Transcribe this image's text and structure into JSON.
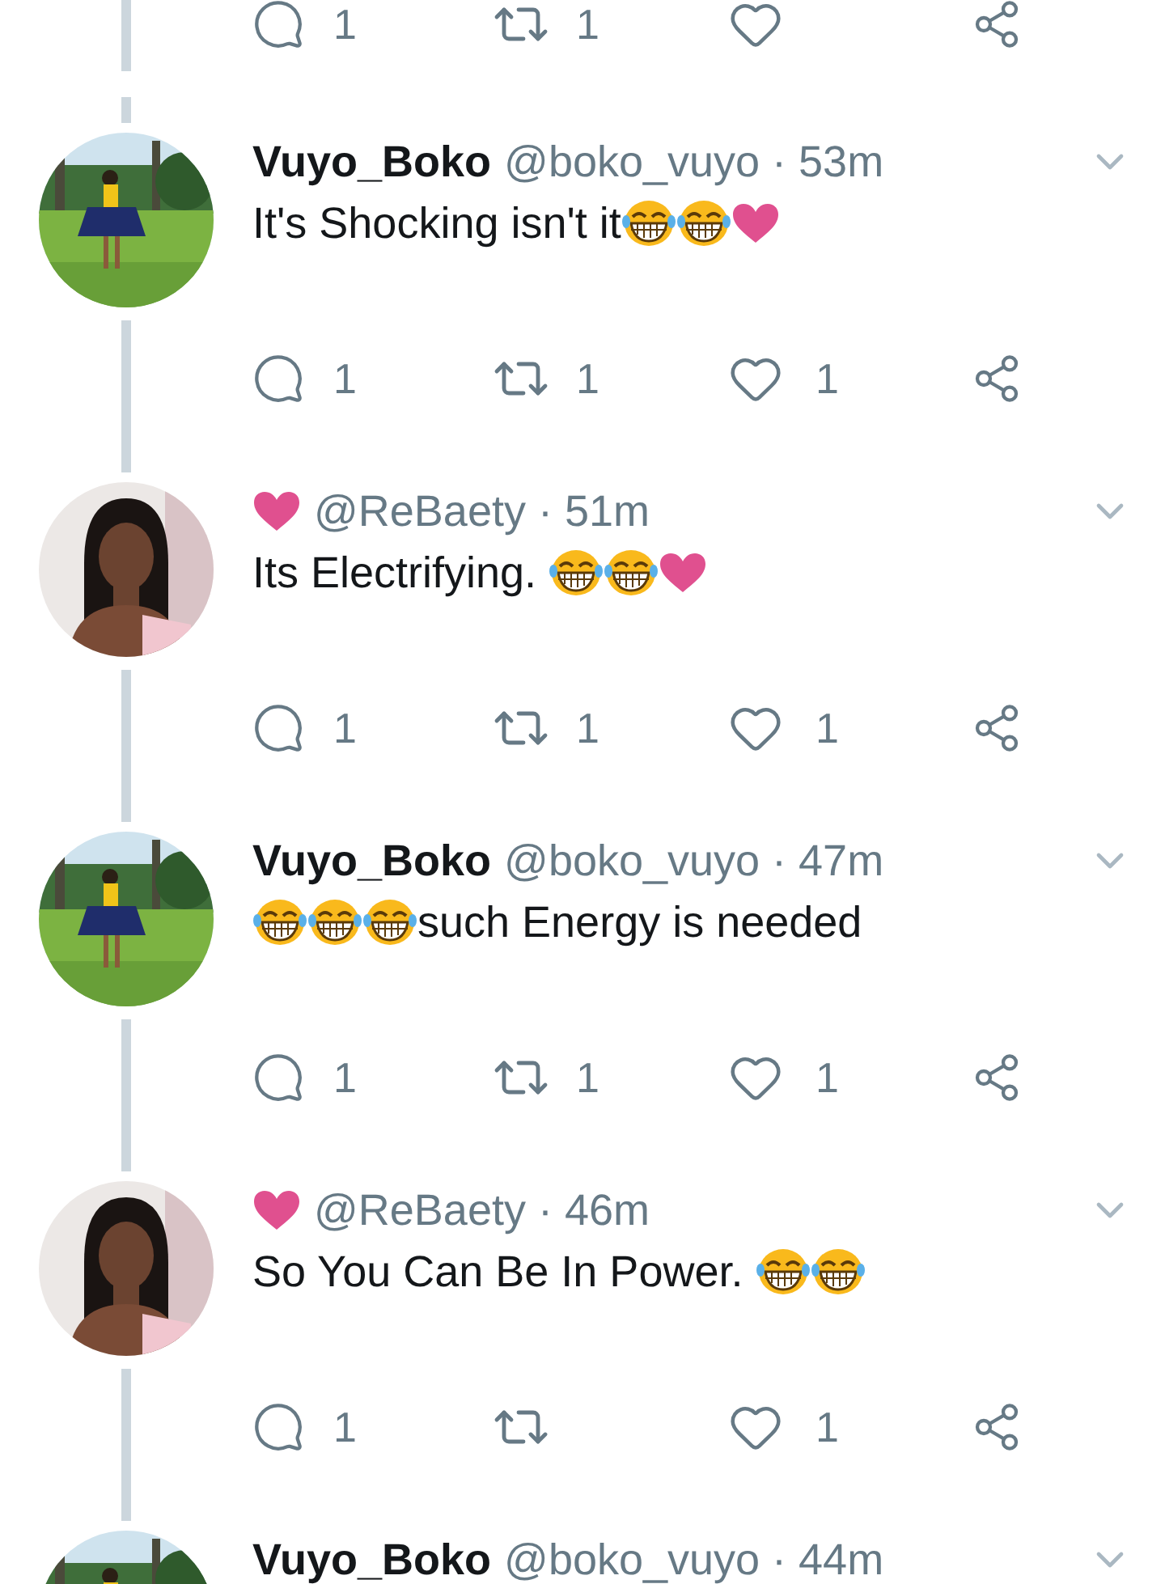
{
  "tweets": [
    {
      "actions": {
        "replies": "1",
        "retweets": "1"
      }
    },
    {
      "name": [
        {
          "kind": "text",
          "text": "Vuyo_Boko"
        }
      ],
      "meta": "@boko_vuyo · 53m",
      "body": [
        {
          "kind": "text",
          "text": "It's Shocking isn't it"
        },
        {
          "kind": "laugh"
        },
        {
          "kind": "laugh"
        },
        {
          "kind": "heart"
        }
      ],
      "actions": {
        "replies": "1",
        "retweets": "1",
        "likes": "1"
      }
    },
    {
      "name": [
        {
          "kind": "heart"
        }
      ],
      "meta": "@ReBaety · 51m",
      "body": [
        {
          "kind": "text",
          "text": "Its Electrifying. "
        },
        {
          "kind": "laugh"
        },
        {
          "kind": "laugh"
        },
        {
          "kind": "heart"
        }
      ],
      "actions": {
        "replies": "1",
        "retweets": "1",
        "likes": "1"
      }
    },
    {
      "name": [
        {
          "kind": "text",
          "text": "Vuyo_Boko"
        }
      ],
      "meta": "@boko_vuyo · 47m",
      "body": [
        {
          "kind": "laugh"
        },
        {
          "kind": "laugh"
        },
        {
          "kind": "laugh"
        },
        {
          "kind": "text",
          "text": "such Energy is needed"
        }
      ],
      "actions": {
        "replies": "1",
        "retweets": "1",
        "likes": "1"
      }
    },
    {
      "name": [
        {
          "kind": "heart"
        }
      ],
      "meta": "@ReBaety · 46m",
      "body": [
        {
          "kind": "text",
          "text": "So You Can Be In Power. "
        },
        {
          "kind": "laugh"
        },
        {
          "kind": "laugh"
        }
      ],
      "actions": {
        "replies": "1",
        "likes": "1"
      }
    },
    {
      "name": [
        {
          "kind": "text",
          "text": "Vuyo_Boko"
        }
      ],
      "meta": "@boko_vuyo · 44m"
    }
  ]
}
